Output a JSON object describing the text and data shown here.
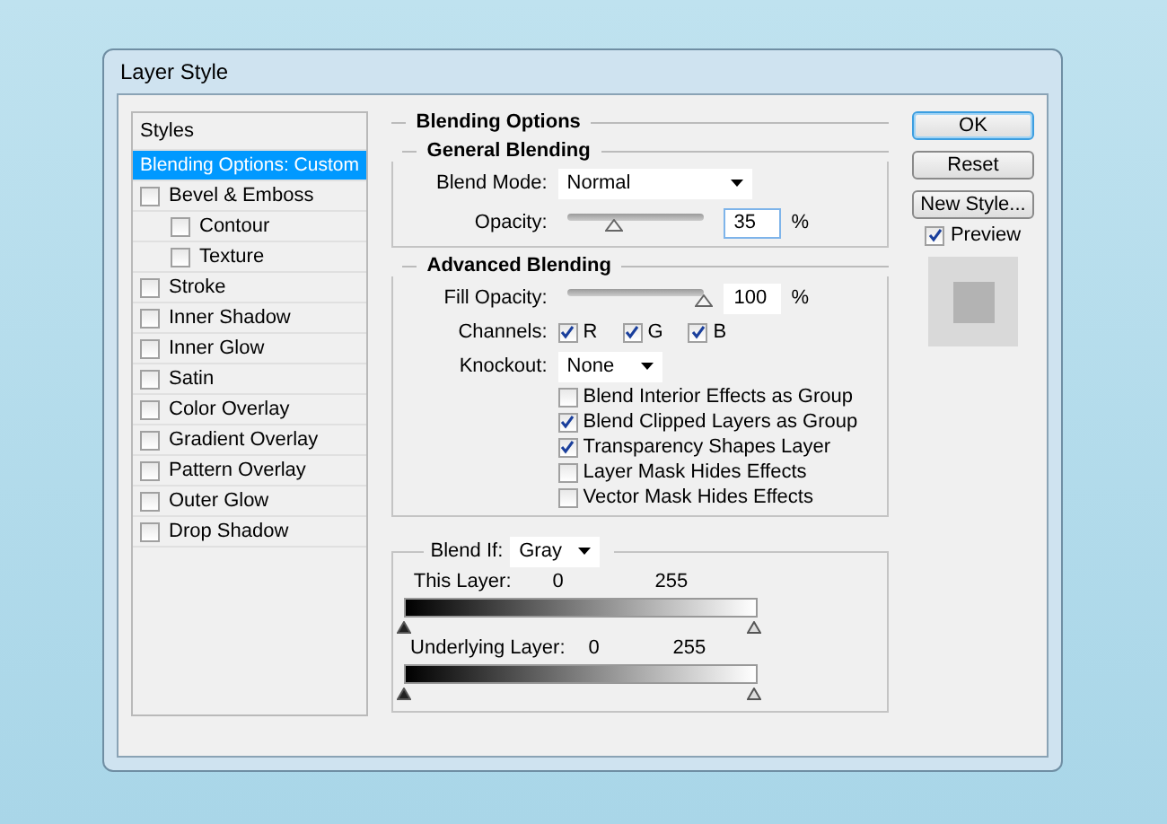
{
  "window": {
    "title": "Layer Style"
  },
  "styles": {
    "header": "Styles",
    "items": [
      {
        "kind": "option",
        "label": "Blending Options: Custom",
        "selected": true
      },
      {
        "kind": "checkbox",
        "label": "Bevel & Emboss",
        "checked": false,
        "selected": false,
        "children": [
          {
            "kind": "checkbox",
            "label": "Contour",
            "checked": false,
            "selected": false
          },
          {
            "kind": "checkbox",
            "label": "Texture",
            "checked": false,
            "selected": false
          }
        ]
      },
      {
        "kind": "checkbox",
        "label": "Stroke",
        "checked": false,
        "selected": false
      },
      {
        "kind": "checkbox",
        "label": "Inner Shadow",
        "checked": false,
        "selected": false
      },
      {
        "kind": "checkbox",
        "label": "Inner Glow",
        "checked": false,
        "selected": false
      },
      {
        "kind": "checkbox",
        "label": "Satin",
        "checked": false,
        "selected": false
      },
      {
        "kind": "checkbox",
        "label": "Color Overlay",
        "checked": false,
        "selected": false
      },
      {
        "kind": "checkbox",
        "label": "Gradient Overlay",
        "checked": false,
        "selected": false
      },
      {
        "kind": "checkbox",
        "label": "Pattern Overlay",
        "checked": false,
        "selected": false
      },
      {
        "kind": "checkbox",
        "label": "Outer Glow",
        "checked": false,
        "selected": false
      },
      {
        "kind": "checkbox",
        "label": "Drop Shadow",
        "checked": false,
        "selected": false
      }
    ]
  },
  "blending_options": {
    "title": "Blending Options",
    "general": {
      "title": "General Blending",
      "blend_mode": {
        "label": "Blend Mode:",
        "value": "Normal"
      },
      "opacity": {
        "label": "Opacity:",
        "level": 0.35,
        "value": "35",
        "unit": "%"
      }
    },
    "advanced": {
      "title": "Advanced Blending",
      "fill_opacity": {
        "label": "Fill Opacity:",
        "level": 1,
        "value": "100",
        "unit": "%"
      },
      "channels": {
        "label": "Channels:",
        "items": [
          {
            "label": "R",
            "checked": true
          },
          {
            "label": "G",
            "checked": true
          },
          {
            "label": "B",
            "checked": true
          }
        ]
      },
      "knockout": {
        "label": "Knockout:",
        "value": "None"
      },
      "options": [
        {
          "label": "Blend Interior Effects as Group",
          "checked": false
        },
        {
          "label": "Blend Clipped Layers as Group",
          "checked": true
        },
        {
          "label": "Transparency Shapes Layer",
          "checked": true
        },
        {
          "label": "Layer Mask Hides Effects",
          "checked": false
        },
        {
          "label": "Vector Mask Hides Effects",
          "checked": false
        }
      ]
    },
    "blend_if": {
      "label": "Blend If:",
      "value": "Gray",
      "layers": [
        {
          "label": "This Layer:",
          "low": "0",
          "high": "255"
        },
        {
          "label": "Underlying Layer:",
          "low": "0",
          "high": "255"
        }
      ]
    }
  },
  "buttons": [
    {
      "label": "OK",
      "default": true
    },
    {
      "label": "Reset",
      "default": false
    },
    {
      "label": "New Style...",
      "default": false
    }
  ],
  "preview": {
    "label": "Preview",
    "checked": true
  }
}
